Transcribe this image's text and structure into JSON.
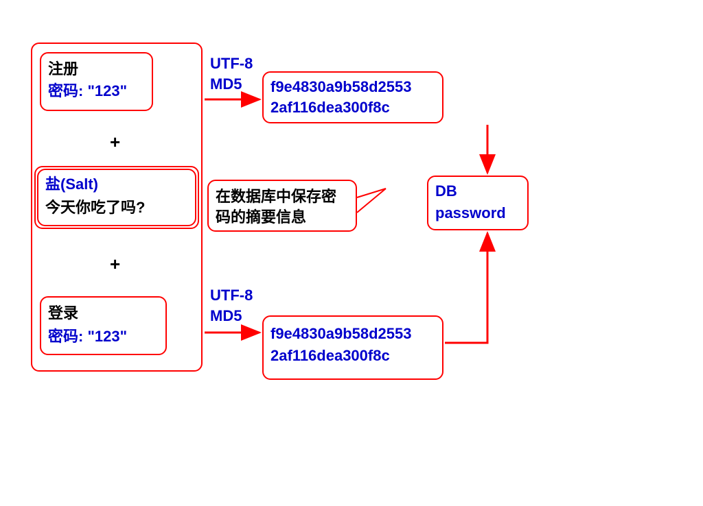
{
  "leftContainer": {
    "register": {
      "line1": "注册",
      "line2": "密码: \"123\""
    },
    "plus1": "+",
    "salt": {
      "line1": "盐(Salt)",
      "line2": "今天你吃了吗?"
    },
    "plus2": "+",
    "login": {
      "line1": "登录",
      "line2": "密码: \"123\""
    }
  },
  "transform1": {
    "line1": "UTF-8",
    "line2": "MD5"
  },
  "transform2": {
    "line1": "UTF-8",
    "line2": "MD5"
  },
  "hash1": {
    "line1": "f9e4830a9b58d2553",
    "line2": "2af116dea300f8c"
  },
  "hash2": {
    "line1": "f9e4830a9b58d2553",
    "line2": "2af116dea300f8c"
  },
  "callout": {
    "line1": "在数据库中保存密",
    "line2": "码的摘要信息"
  },
  "db": {
    "line1": "DB",
    "line2": "password"
  }
}
